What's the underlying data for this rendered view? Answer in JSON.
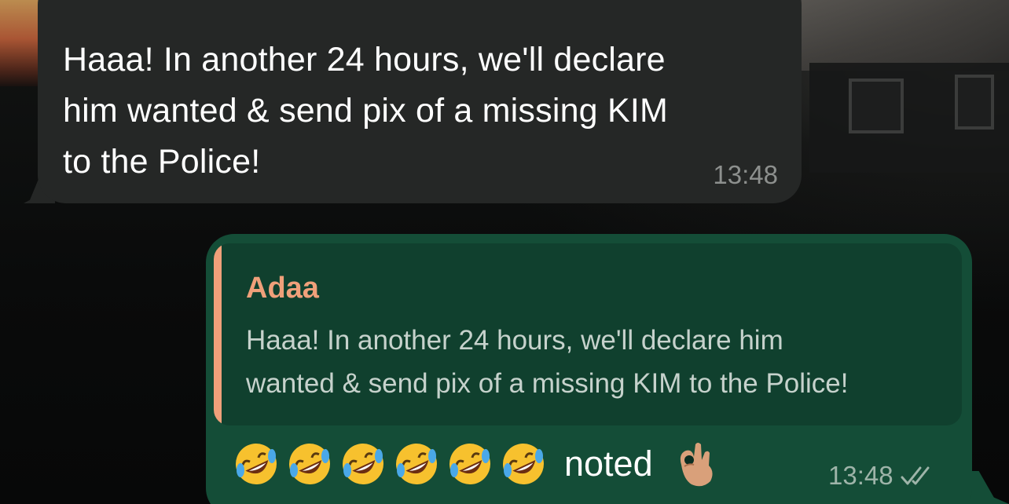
{
  "incoming_message": {
    "text": "Haaa! In another 24 hours, we'll declare\nhim wanted & send pix of a missing KIM\nto the Police!",
    "time": "13:48"
  },
  "outgoing_message": {
    "reply": {
      "sender": "Adaa",
      "quoted_text": "Haaa! In another 24 hours, we'll declare him\nwanted & send pix of a missing KIM to the Police!"
    },
    "emojis": [
      "rolling-on-floor-laughing",
      "rolling-on-floor-laughing",
      "rolling-on-floor-laughing",
      "rolling-on-floor-laughing",
      "rolling-on-floor-laughing",
      "rolling-on-floor-laughing"
    ],
    "text": "noted",
    "trailing_emoji": "ok-hand-medium-skin-tone",
    "time": "13:48",
    "status_icon": "double-check-icon"
  },
  "colors": {
    "incoming_bubble": "#252726",
    "outgoing_bubble": "#144d37",
    "reply_box": "#10402e",
    "reply_accent": "#f0a07a",
    "timestamp_in": "#8d908e",
    "timestamp_out": "#9eb4a9"
  }
}
